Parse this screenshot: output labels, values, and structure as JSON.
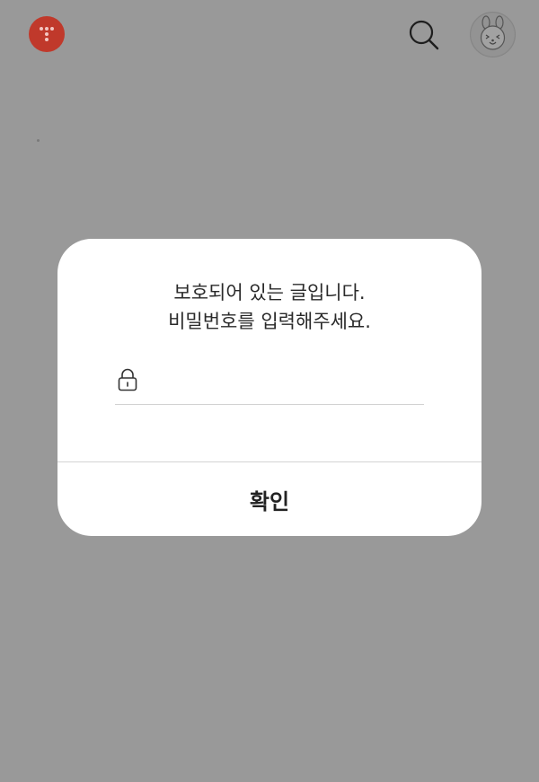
{
  "header": {
    "logo_icon": "dots-logo-icon",
    "logo_color": "#c0392b",
    "search_icon": "search-icon",
    "avatar_icon": "bunny-character-avatar"
  },
  "overlay": {
    "scrim_color": "#999999"
  },
  "dialog": {
    "message_line1": "보호되어 있는 글입니다.",
    "message_line2": "비밀번호를 입력해주세요.",
    "password": {
      "icon": "lock-icon",
      "value": "",
      "placeholder": ""
    },
    "confirm_label": "확인"
  }
}
